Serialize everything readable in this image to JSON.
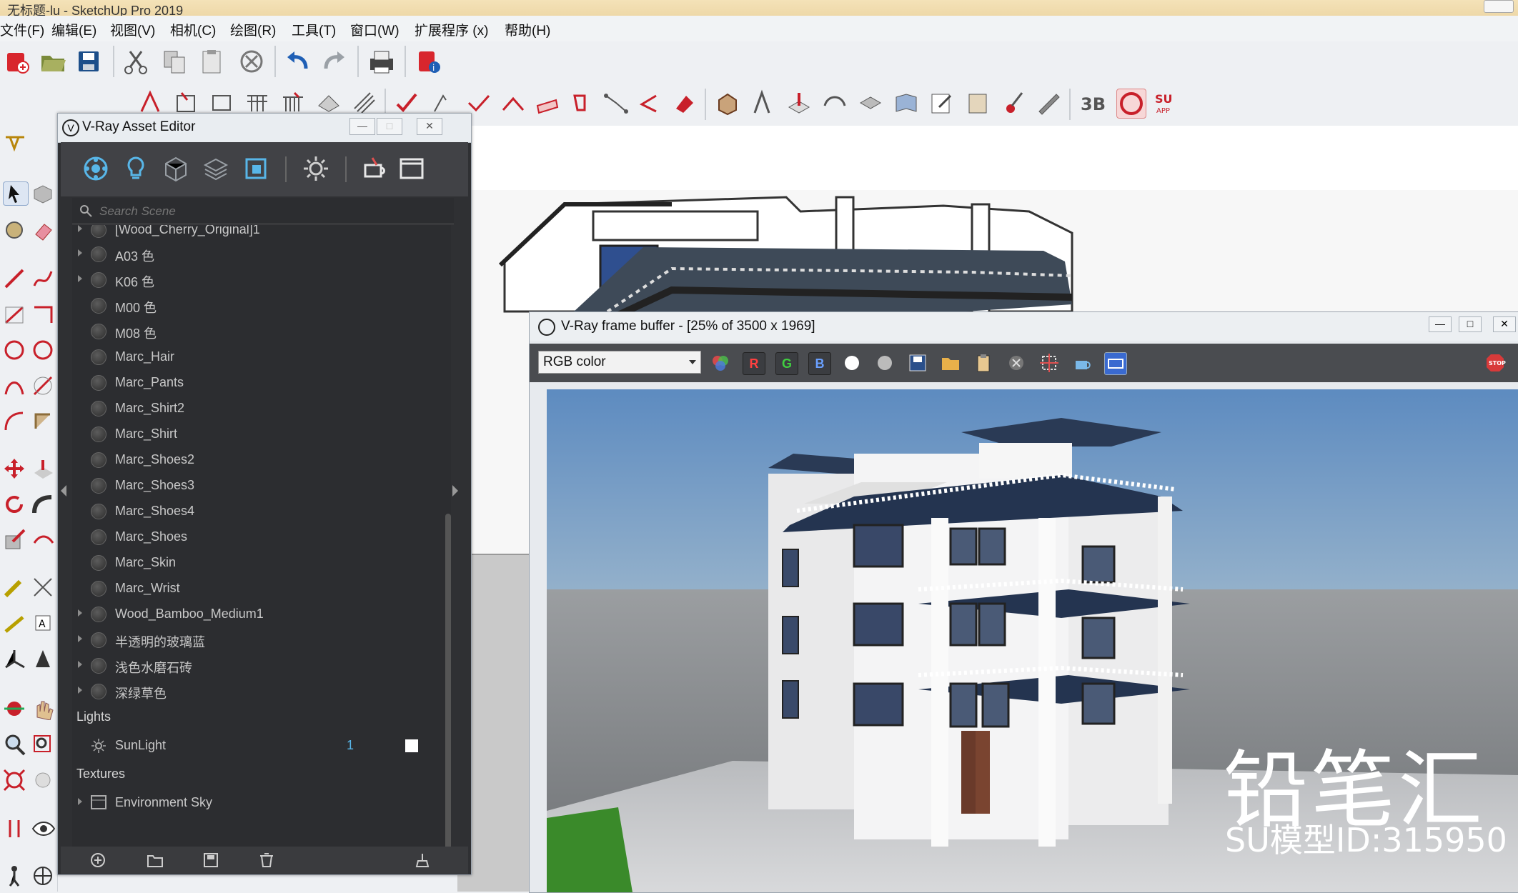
{
  "window": {
    "title": "无标题-lu - SketchUp Pro 2019"
  },
  "menus": [
    "文件(F)",
    "编辑(E)",
    "视图(V)",
    "相机(C)",
    "绘图(R)",
    "工具(T)",
    "窗口(W)",
    "扩展程序 (x)",
    "帮助(H)"
  ],
  "asset_editor": {
    "title": "V-Ray Asset Editor",
    "search_placeholder": "Search Scene",
    "materials": [
      "[Wood_Cherry_Original]1",
      "A03 色",
      "K06 色",
      "M00 色",
      "M08 色",
      "Marc_Hair",
      "Marc_Pants",
      "Marc_Shirt2",
      "Marc_Shirt",
      "Marc_Shoes2",
      "Marc_Shoes3",
      "Marc_Shoes4",
      "Marc_Shoes",
      "Marc_Skin",
      "Marc_Wrist",
      "Wood_Bamboo_Medium1",
      "半透明的玻璃蓝",
      "浅色水磨石砖",
      "深绿草色"
    ],
    "lights_header": "Lights",
    "light_name": "SunLight",
    "light_count": "1",
    "textures_header": "Textures",
    "texture_name": "Environment Sky"
  },
  "frame_buffer": {
    "title": "V-Ray frame buffer - [25% of 3500 x 1969]",
    "channel": "RGB color",
    "btn_r": "R",
    "btn_g": "G",
    "btn_b": "B",
    "stop_label": "STOP"
  },
  "watermark": {
    "big": "铅笔汇",
    "id_text": "SU模型ID:315950"
  },
  "colors": {
    "sky_top": "#5f8cc0",
    "sky_bottom": "#c7d3da",
    "editor_bg": "#2c2d30",
    "accent_red": "#c8202a"
  }
}
